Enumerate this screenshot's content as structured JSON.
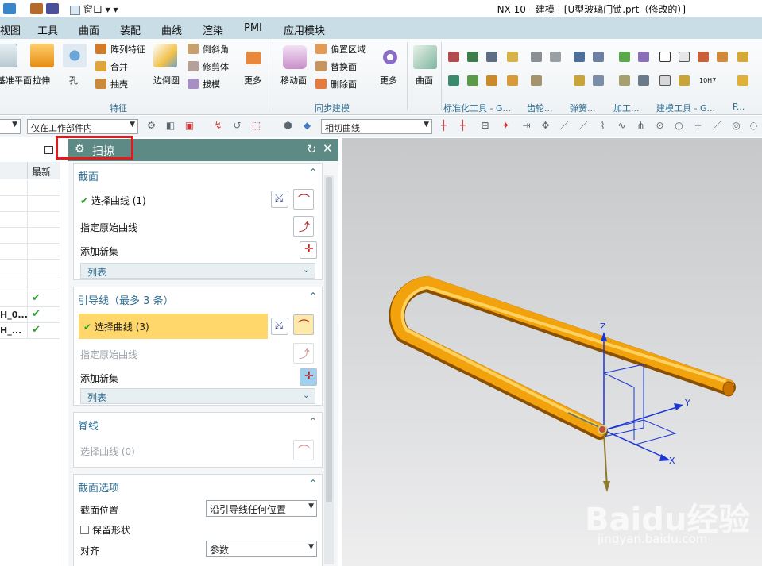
{
  "window": {
    "title": "NX 10 - 建模 - [U型玻璃门锁.prt（修改的）]",
    "window_menu": "窗口"
  },
  "menubar": {
    "items": [
      "视图",
      "工具",
      "曲面",
      "装配",
      "曲线",
      "渲染",
      "PMI",
      "应用模块"
    ]
  },
  "ribbon": {
    "feature_group": {
      "label": "特征",
      "items": [
        "基准平面",
        "拉伸",
        "孔",
        "阵列特征",
        "合并",
        "抽壳",
        "边倒圆",
        "倒斜角",
        "修剪体",
        "拔模",
        "更多"
      ]
    },
    "sync_group": {
      "label": "同步建模",
      "items": [
        "移动面",
        "偏置区域",
        "替换面",
        "删除面",
        "更多"
      ]
    },
    "surface": {
      "label": "曲面"
    },
    "std_tools": {
      "label": "标准化工具 - G..."
    },
    "gear": {
      "label": "齿轮..."
    },
    "spring": {
      "label": "弹簧..."
    },
    "process": {
      "label": "加工..."
    },
    "model_tools": {
      "label": "建模工具 - G..."
    },
    "misc": {
      "label": "P...",
      "text_10h7": "10H7"
    }
  },
  "toolbar": {
    "filter_value": "仅在工作部件内",
    "curve_rule": "相切曲线"
  },
  "nav": {
    "header": "最新",
    "rows": [
      {
        "name": "",
        "check": false
      },
      {
        "name": "",
        "check": false
      },
      {
        "name": "",
        "check": false
      },
      {
        "name": "",
        "check": false
      },
      {
        "name": "",
        "check": false
      },
      {
        "name": "",
        "check": false
      },
      {
        "name": "",
        "check": false
      },
      {
        "name": "",
        "check": true
      },
      {
        "name": "H_0...",
        "check": true
      },
      {
        "name": "H_...",
        "check": true
      }
    ]
  },
  "dialog": {
    "title": "扫掠",
    "section": {
      "title": "截面",
      "select_curve": "选择曲线 (1)",
      "specify_origin": "指定原始曲线",
      "add_set": "添加新集",
      "list": "列表"
    },
    "guide": {
      "title": "引导线（最多 3 条）",
      "select_curve": "选择曲线 (3)",
      "specify_origin": "指定原始曲线",
      "add_set": "添加新集",
      "list": "列表"
    },
    "spine": {
      "title": "脊线",
      "select_curve": "选择曲线 (0)"
    },
    "options": {
      "title": "截面选项",
      "position_label": "截面位置",
      "position_value": "沿引导线任何位置",
      "keep_shape": "保留形状",
      "align_label": "对齐",
      "align_value": "参数"
    }
  },
  "viewport": {
    "axes": {
      "x": "X",
      "y": "Y",
      "z": "Z"
    },
    "watermark": "Baidu经验",
    "watermark_url": "jingyan.baidu.com"
  },
  "colors": {
    "accent": "#5d8a84",
    "highlight": "#ffd76a",
    "pipe": "#f2a20c",
    "label": "#2f6f93"
  }
}
